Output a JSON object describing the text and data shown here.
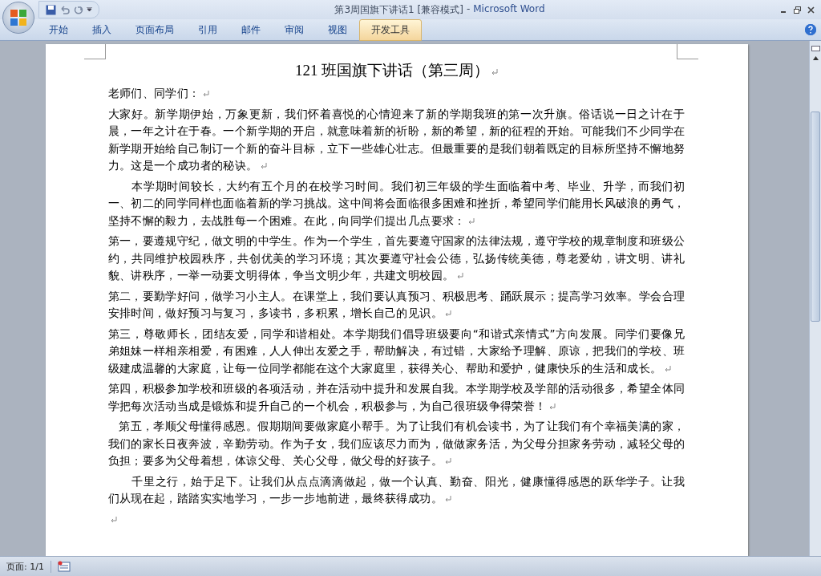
{
  "window": {
    "title": "第3周国旗下讲话1 [兼容模式]",
    "separator": "-",
    "app_name": "Microsoft Word"
  },
  "tabs": [
    {
      "label": "开始",
      "selected": false
    },
    {
      "label": "插入",
      "selected": false
    },
    {
      "label": "页面布局",
      "selected": false
    },
    {
      "label": "引用",
      "selected": false
    },
    {
      "label": "邮件",
      "selected": false
    },
    {
      "label": "审阅",
      "selected": false
    },
    {
      "label": "视图",
      "selected": false
    },
    {
      "label": "开发工具",
      "selected": true
    }
  ],
  "document": {
    "title": "121 班国旗下讲话（第三周）",
    "paragraphs": [
      {
        "kind": "plain",
        "text": "老师们、同学们："
      },
      {
        "kind": "plain",
        "text": "大家好。新学期伊始，万象更新，我们怀着喜悦的心情迎来了新的学期我班的第一次升旗。俗话说一日之计在于晨，一年之计在于春。一个新学期的开启，就意味着新的祈盼，新的希望，新的征程的开始。可能我们不少同学在新学期开始给自己制订一个新的奋斗目标，立下一些雄心壮志。但最重要的是我们朝着既定的目标所坚持不懈地努力。这是一个成功者的秘诀。"
      },
      {
        "kind": "indented",
        "text": "本学期时间较长，大约有五个月的在校学习时间。我们初三年级的学生面临着中考、毕业、升学，而我们初一、初二的同学同样也面临着新的学习挑战。这中间将会面临很多困难和挫折，希望同学们能用长风破浪的勇气，坚持不懈的毅力，去战胜每一个困难。在此，向同学们提出几点要求："
      },
      {
        "kind": "plain",
        "text": "第一，要遵规守纪，做文明的中学生。作为一个学生，首先要遵守国家的法律法规，遵守学校的规章制度和班级公约，共同维护校园秩序，共创优美的学习环境；其次要遵守社会公德，弘扬传统美德，尊老爱幼，讲文明、讲礼貌、讲秩序，一举一动要文明得体，争当文明少年，共建文明校园。"
      },
      {
        "kind": "plain",
        "text": "第二，要勤学好问，做学习小主人。在课堂上，我们要认真预习、积极思考、踊跃展示；提高学习效率。学会合理安排时间，做好预习与复习，多读书，多积累，增长自己的见识。"
      },
      {
        "kind": "plain",
        "text": "第三，尊敬师长，团结友爱，同学和谐相处。本学期我们倡导班级要向“和谐式亲情式”方向发展。同学们要像兄弟姐妹一样相亲相爱，有困难，人人伸出友爱之手，帮助解决，有过错，大家给予理解、原谅，把我们的学校、班级建成温馨的大家庭，让每一位同学都能在这个大家庭里，获得关心、帮助和爱护，健康快乐的生活和成长。"
      },
      {
        "kind": "plain",
        "text": "第四，积极参加学校和班级的各项活动，并在活动中提升和发展自我。本学期学校及学部的活动很多，希望全体同学把每次活动当成是锻炼和提升自己的一个机会，积极参与，为自己很班级争得荣誉！"
      },
      {
        "kind": "half",
        "text": "第五，孝顺父母懂得感恩。假期期间要做家庭小帮手。为了让我们有机会读书，为了让我们有个幸福美满的家，我们的家长日夜奔波，辛勤劳动。作为子女，我们应该尽力而为，做做家务活，为父母分担家务劳动，减轻父母的负担；要多为父母着想，体谅父母、关心父母，做父母的好孩子。"
      },
      {
        "kind": "indented",
        "text": "千里之行，始于足下。让我们从点点滴滴做起，做一个认真、勤奋、阳光，健康懂得感恩的跃华学子。让我们从现在起，踏踏实实地学习，一步一步地前进，最终获得成功。"
      }
    ]
  },
  "status_bar": {
    "page": "页面: 1/1"
  }
}
